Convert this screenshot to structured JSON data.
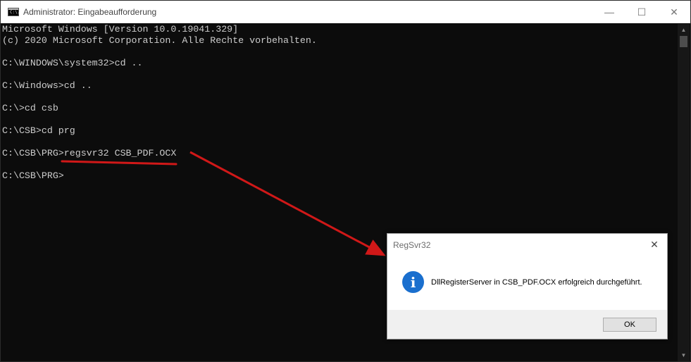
{
  "window": {
    "title": "Administrator: Eingabeaufforderung",
    "icon_label": "C:\\.",
    "minimize_glyph": "—",
    "maximize_glyph": "☐",
    "close_glyph": "✕"
  },
  "console": {
    "lines": [
      "Microsoft Windows [Version 10.0.19041.329]",
      "(c) 2020 Microsoft Corporation. Alle Rechte vorbehalten.",
      "",
      "C:\\WINDOWS\\system32>cd ..",
      "",
      "C:\\Windows>cd ..",
      "",
      "C:\\>cd csb",
      "",
      "C:\\CSB>cd prg",
      "",
      "C:\\CSB\\PRG>regsvr32 CSB_PDF.OCX",
      "",
      "C:\\CSB\\PRG>"
    ]
  },
  "scrollbar": {
    "up_glyph": "▲",
    "down_glyph": "▼"
  },
  "annotation": {
    "color": "#d01818"
  },
  "dialog": {
    "title": "RegSvr32",
    "close_glyph": "✕",
    "icon_name": "info-icon",
    "icon_glyph": "i",
    "message": "DllRegisterServer in CSB_PDF.OCX erfolgreich durchgeführt.",
    "ok_label": "OK"
  },
  "colors": {
    "console_bg": "#0c0c0c",
    "console_text": "#cccccc",
    "info_blue": "#1a6fce",
    "arrow_red": "#d01818"
  }
}
